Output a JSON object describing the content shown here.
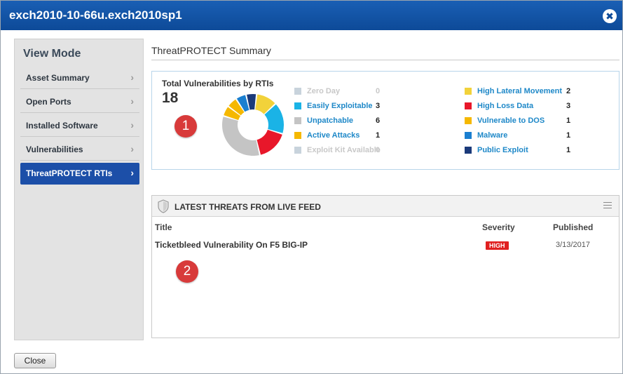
{
  "window": {
    "title": "exch2010-10-66u.exch2010sp1",
    "close_glyph": "✖"
  },
  "sidebar": {
    "heading": "View Mode",
    "items": [
      {
        "label": "Asset Summary",
        "active": false
      },
      {
        "label": "Open Ports",
        "active": false
      },
      {
        "label": "Installed Software",
        "active": false
      },
      {
        "label": "Vulnerabilities",
        "active": false
      },
      {
        "label": "ThreatPROTECT RTIs",
        "active": true
      }
    ],
    "chevron": "›"
  },
  "summary": {
    "title": "ThreatPROTECT Summary"
  },
  "rti": {
    "title": "Total Vulnerabilities by RTIs",
    "total": "18",
    "legend_left": [
      {
        "name": "Zero Day",
        "count": "0",
        "color": "#c8d3dc",
        "dim": true
      },
      {
        "name": "Easily Exploitable",
        "count": "3",
        "color": "#1ab3e6",
        "dim": false
      },
      {
        "name": "Unpatchable",
        "count": "6",
        "color": "#c4c4c4",
        "dim": false
      },
      {
        "name": "Active Attacks",
        "count": "1",
        "color": "#f5b800",
        "dim": false
      },
      {
        "name": "Exploit Kit Available",
        "count": "0",
        "color": "#c8d3dc",
        "dim": true
      }
    ],
    "legend_right": [
      {
        "name": "High Lateral Movement",
        "count": "2",
        "color": "#f2d23a",
        "dim": false
      },
      {
        "name": "High Loss Data",
        "count": "3",
        "color": "#e8172a",
        "dim": false
      },
      {
        "name": "Vulnerable to DOS",
        "count": "1",
        "color": "#f5b800",
        "dim": false
      },
      {
        "name": "Malware",
        "count": "1",
        "color": "#1a7fd0",
        "dim": false
      },
      {
        "name": "Public Exploit",
        "count": "1",
        "color": "#1b3a7a",
        "dim": false
      }
    ],
    "segments": [
      {
        "label": "High Lateral Movement",
        "value": 2,
        "color": "#f2d23a"
      },
      {
        "label": "Easily Exploitable",
        "value": 3,
        "color": "#1ab3e6"
      },
      {
        "label": "High Loss Data",
        "value": 3,
        "color": "#e8172a"
      },
      {
        "label": "Unpatchable",
        "value": 6,
        "color": "#c4c4c4"
      },
      {
        "label": "Active Attacks",
        "value": 1,
        "color": "#f5b800"
      },
      {
        "label": "Vulnerable to DOS",
        "value": 1,
        "color": "#f5b800"
      },
      {
        "label": "Malware",
        "value": 1,
        "color": "#1a7fd0"
      },
      {
        "label": "Public Exploit",
        "value": 1,
        "color": "#1b3a7a"
      }
    ],
    "badge": "1"
  },
  "feed": {
    "title": "LATEST THREATS FROM LIVE FEED",
    "columns": {
      "title": "Title",
      "severity": "Severity",
      "published": "Published"
    },
    "rows": [
      {
        "title": "Ticketbleed Vulnerability On F5 BIG-IP",
        "severity": "HIGH",
        "published": "3/13/2017"
      }
    ],
    "badge": "2"
  },
  "footer": {
    "close_label": "Close"
  }
}
